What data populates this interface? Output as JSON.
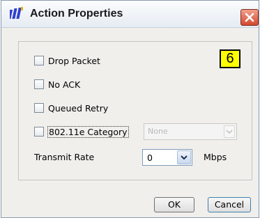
{
  "window": {
    "title": "Action Properties",
    "icons": {
      "app": "app-logo-icon",
      "close": "close-icon"
    },
    "colors": {
      "close_button": "#d2492f",
      "badge": "#ffff00"
    }
  },
  "badge": {
    "value": "6"
  },
  "options": [
    {
      "label": "Drop Packet",
      "checked": false
    },
    {
      "label": "No ACK",
      "checked": false
    },
    {
      "label": "Queued Retry",
      "checked": false
    },
    {
      "label": "802.11e Category",
      "checked": false
    }
  ],
  "category_select": {
    "value": "None",
    "enabled": false
  },
  "transmit_rate": {
    "label": "Transmit Rate",
    "value": "0",
    "unit": "Mbps"
  },
  "buttons": {
    "ok": "OK",
    "cancel": "Cancel"
  }
}
